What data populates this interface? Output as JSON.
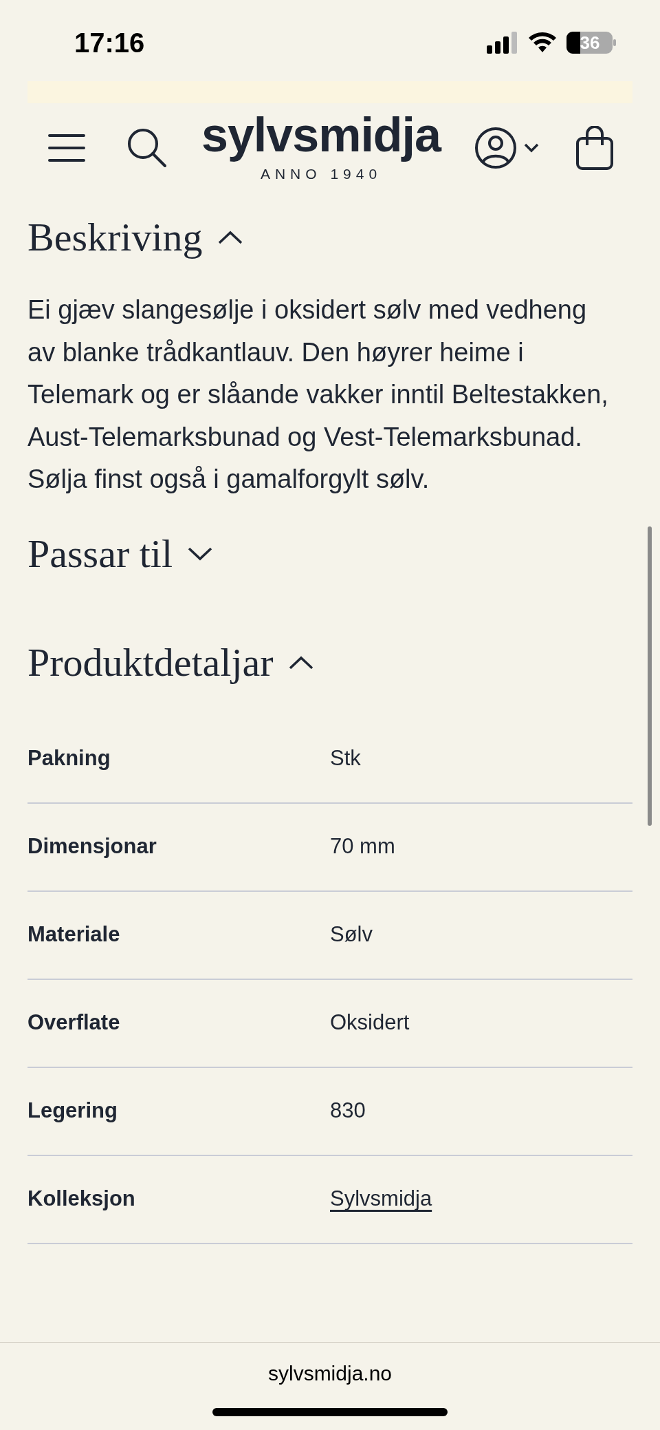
{
  "status_bar": {
    "time": "17:16",
    "battery": "36"
  },
  "header": {
    "logo": "sylvsmidja",
    "tagline": "ANNO 1940"
  },
  "sections": [
    {
      "title": "Beskriving",
      "expanded": true,
      "kind": "text",
      "text": "Ei gjæv slangesølje i oksidert sølv med vedheng av blanke trådkantlauv. Den høyrer heime i Telemark og er slåande vakker inntil Beltestakken, Aust-Telemarksbunad og Vest-Telemarksbunad. Sølja finst også i gamalforgylt sølv."
    },
    {
      "title": "Passar til",
      "expanded": false
    },
    {
      "title": "Produktdetaljar",
      "expanded": true,
      "kind": "table",
      "rows": [
        {
          "label": "Pakning",
          "value": "Stk",
          "kind": "text"
        },
        {
          "label": "Dimensjonar",
          "value": "70 mm",
          "kind": "text"
        },
        {
          "label": "Materiale",
          "value": "Sølv",
          "kind": "text"
        },
        {
          "label": "Overflate",
          "value": "Oksidert",
          "kind": "text"
        },
        {
          "label": "Legering",
          "value": "830",
          "kind": "text"
        },
        {
          "label": "Kolleksjon",
          "value": "Sylvsmidja",
          "kind": "link"
        }
      ]
    }
  ],
  "browser": {
    "url": "sylvsmidja.no"
  }
}
